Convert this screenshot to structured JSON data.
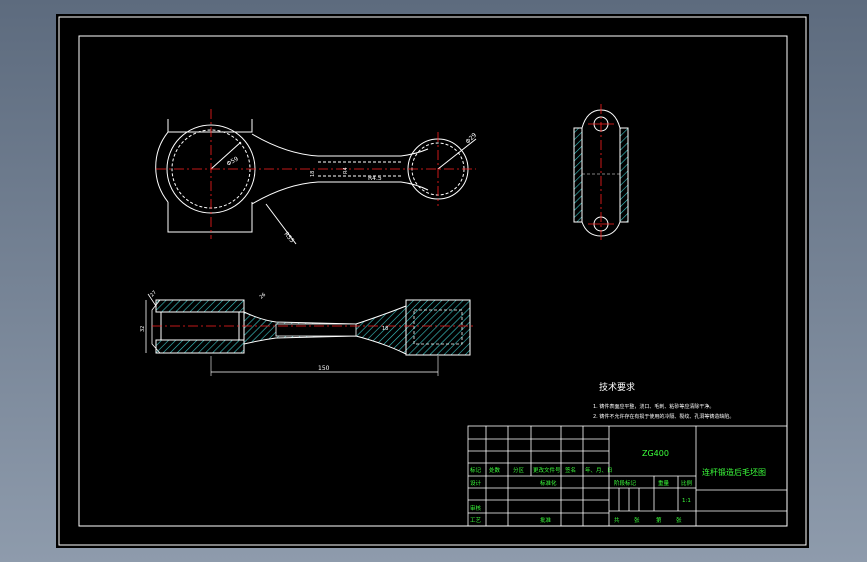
{
  "dimensions": {
    "big_end_dia": "Φ59",
    "small_end_dia": "Φ29",
    "radius_1": "R55",
    "shank_w": "18",
    "shank_r": "R4",
    "shank_w2": "R4.5",
    "side_w": "32",
    "side_d": "27",
    "center_distance": "150",
    "rib": "26",
    "rib2": "18"
  },
  "tech_requirements": {
    "title": "技术要求",
    "items": [
      "1. 铸件表面应平整，浇口、毛刺、粘砂等应清除干净。",
      "2. 铸件不允许存在有损于使用的冷隔、裂纹、孔洞等铸造缺陷。"
    ]
  },
  "title_block": {
    "material": "ZG400",
    "drawing_name": "连杆锻造后毛坯图",
    "labels": {
      "mark": "标记",
      "count": "处数",
      "zone": "分区",
      "doc_no": "更改文件号",
      "sign": "签名",
      "date": "年、月、日",
      "design": "设计",
      "standard": "标准化",
      "review": "审核",
      "process": "工艺",
      "approve": "批准",
      "stage_mark": "阶段标记",
      "weight": "重量",
      "scale": "比例",
      "scale_val": "1:1",
      "sheets_total": "共",
      "sheets_unit1": "张",
      "sheet_no": "第",
      "sheets_unit2": "张"
    }
  },
  "colors": {
    "outline": "#ffffff",
    "centerline": "#ff2020",
    "hatch": "#3ec9c9",
    "dim": "#ffffff",
    "frame": "#ffffff",
    "material_text": "#3cff3c"
  }
}
